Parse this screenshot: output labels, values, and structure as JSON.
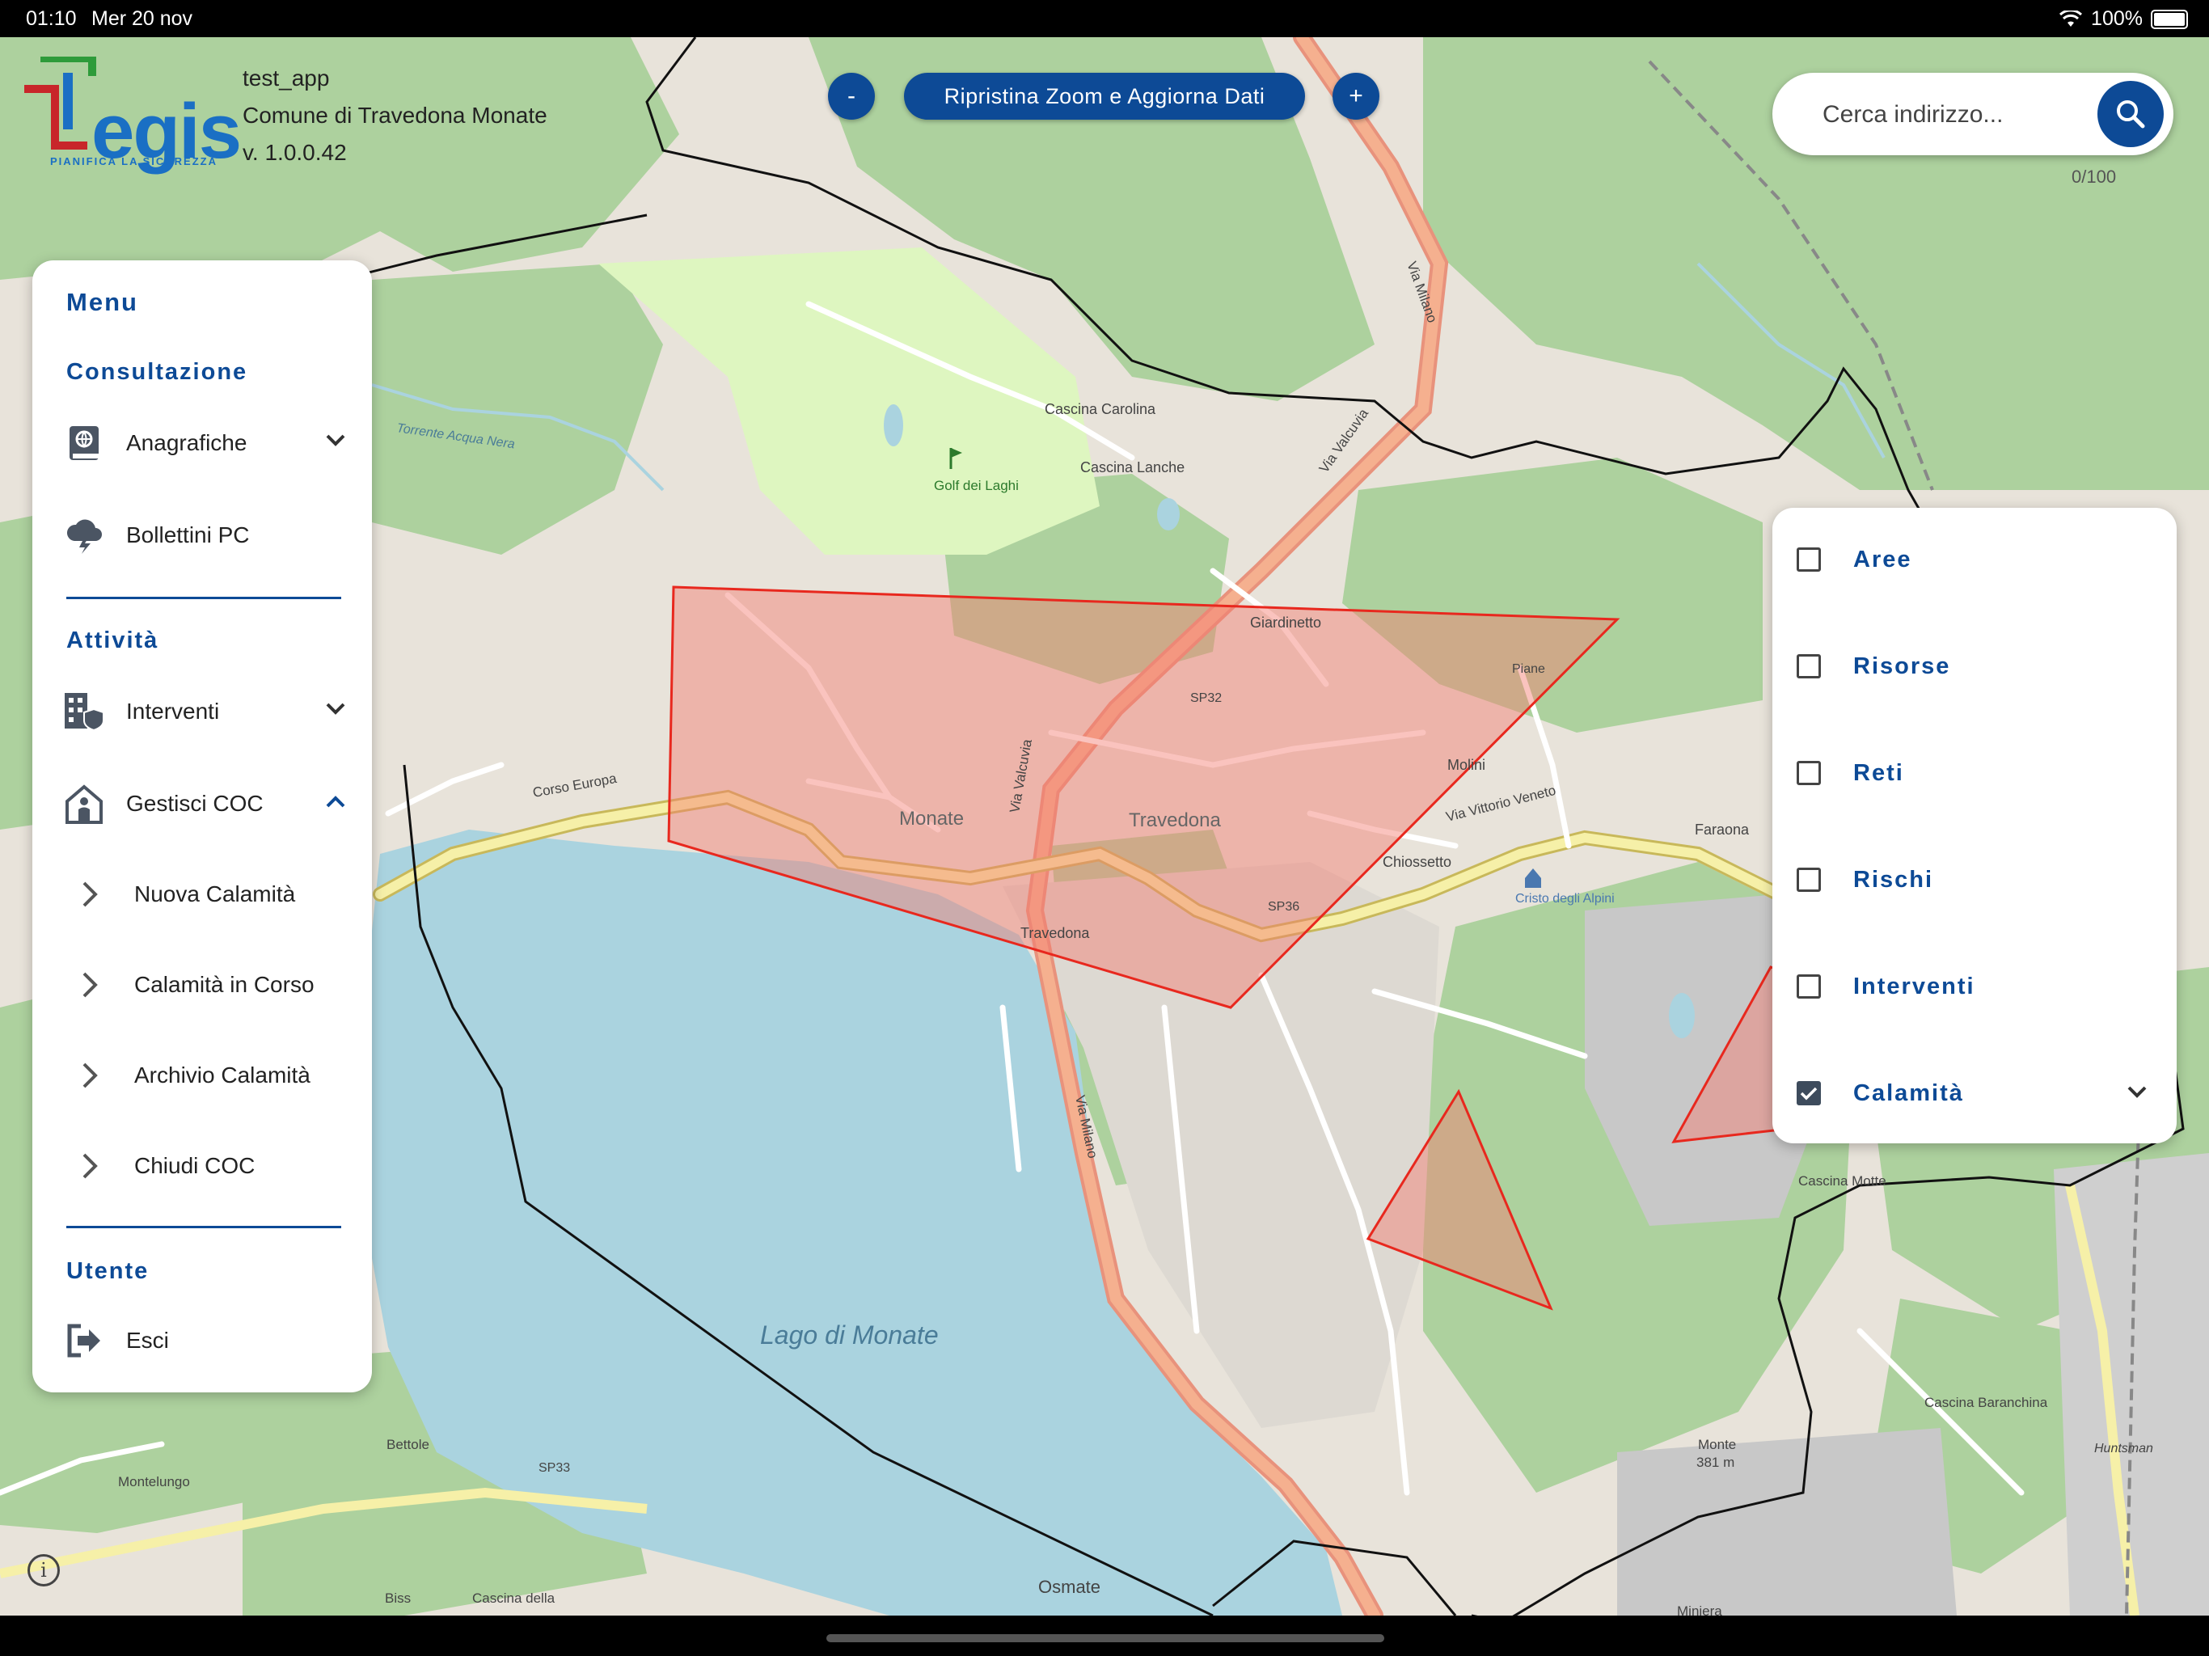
{
  "status_bar": {
    "time": "01:10",
    "date": "Mer 20 nov",
    "battery": "100%"
  },
  "app": {
    "logo_text": "egis",
    "logo_tagline": "PIANIFICA LA SICUREZZA",
    "app_name": "test_app",
    "municipality": "Comune di Travedona Monate",
    "version": "v. 1.0.0.42"
  },
  "zoom": {
    "minus": "-",
    "plus": "+",
    "reset_label": "Ripristina Zoom e Aggiorna Dati"
  },
  "search": {
    "placeholder": "Cerca indirizzo...",
    "counter": "0/100"
  },
  "menu": {
    "title": "Menu",
    "sections": {
      "consultazione": "Consultazione",
      "attivita": "Attività",
      "utente": "Utente"
    },
    "items": {
      "anagrafiche": "Anagrafiche",
      "bollettini": "Bollettini PC",
      "interventi": "Interventi",
      "gestisci_coc": "Gestisci COC",
      "nuova_calamita": "Nuova Calamità",
      "calamita_in_corso": "Calamità in Corso",
      "archivio_calamita": "Archivio Calamità",
      "chiudi_coc": "Chiudi COC",
      "esci": "Esci"
    }
  },
  "layers": [
    {
      "label": "Aree",
      "checked": false
    },
    {
      "label": "Risorse",
      "checked": false
    },
    {
      "label": "Reti",
      "checked": false
    },
    {
      "label": "Rischi",
      "checked": false
    },
    {
      "label": "Interventi",
      "checked": false
    },
    {
      "label": "Calamità",
      "checked": true
    }
  ],
  "map_labels": {
    "lake": "Lago di Monate",
    "golf": "Golf dei Laghi",
    "travedona": "Travedona",
    "monate": "Monate",
    "giardinetto": "Giardinetto",
    "cascina_carolina": "Cascina Carolina",
    "cascina_lanche": "Cascina Lanche",
    "chiossetto": "Chiossetto",
    "molini": "Molini",
    "faraona": "Faraona",
    "cristo": "Cristo degli Alpini",
    "via_milano": "Via Milano",
    "via_valcuvia": "Via Valcuvia",
    "corso_europa": "Corso Europa",
    "via_vittorio_veneto": "Via Vittorio Veneto",
    "sp32": "SP32",
    "sp36": "SP36",
    "sp33": "SP33",
    "bettole": "Bettole",
    "montelungo": "Montelungo",
    "osmate": "Osmate",
    "cascina_baranchina": "Cascina Baranchina",
    "cascina_motte": "Cascina Motte",
    "monte": "Monte",
    "monte_alt": "381 m",
    "biss": "Biss",
    "miniera": "Miniera",
    "huntsman": "Huntsman",
    "cascina_della": "Cascina della",
    "torrente": "Torrente Acqua Nera",
    "piane": "Piane"
  },
  "colors": {
    "primary": "#0d4a96",
    "calamity_stroke": "#e8281e",
    "calamity_fill": "#f47a6e",
    "lake": "#aad3df",
    "forest": "#add19e",
    "golf": "#def6c0"
  }
}
